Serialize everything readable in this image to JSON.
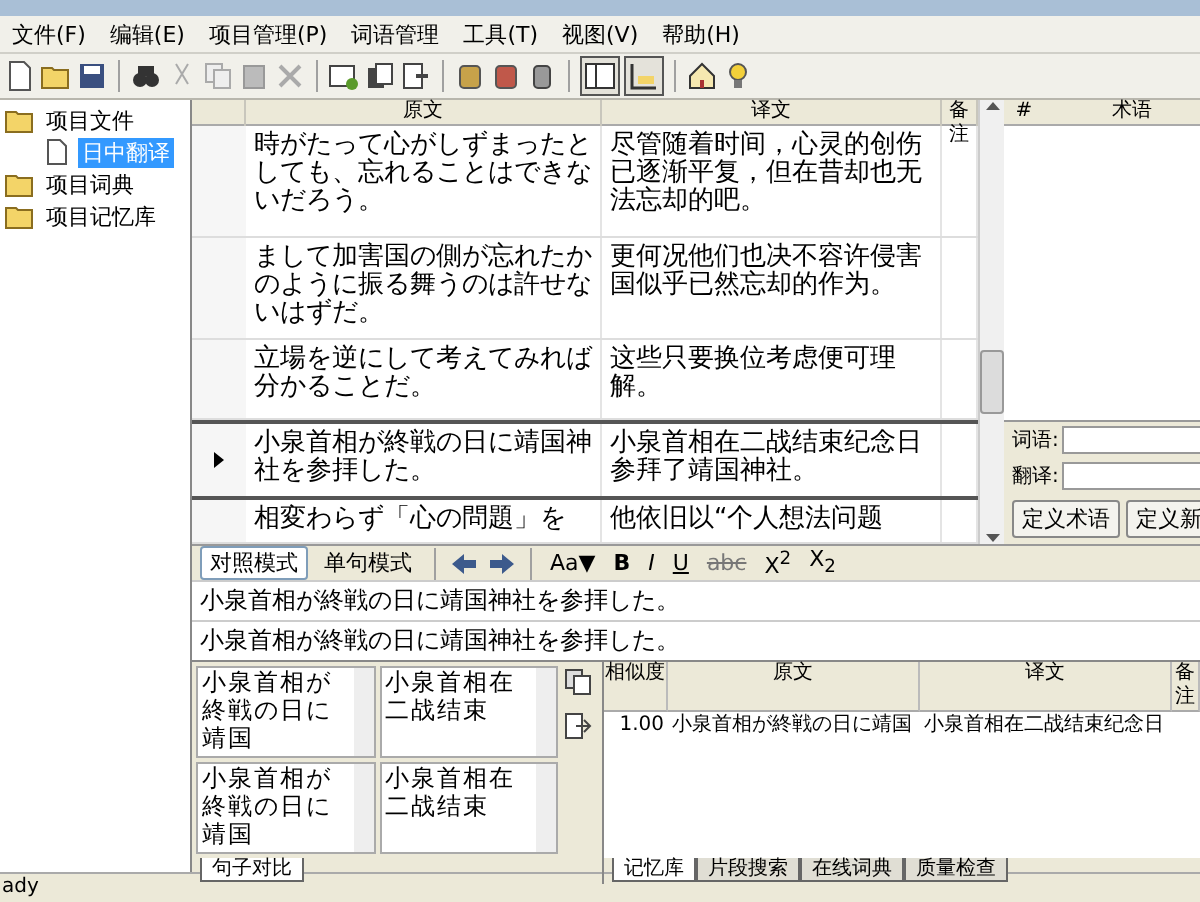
{
  "menu": [
    "文件(F)",
    "编辑(E)",
    "项目管理(P)",
    "词语管理",
    "工具(T)",
    "视图(V)",
    "帮助(H)"
  ],
  "tree": [
    {
      "label": "项目文件",
      "selected": false,
      "children": [
        {
          "label": "日中翻译",
          "selected": true
        }
      ]
    },
    {
      "label": "项目词典",
      "selected": false
    },
    {
      "label": "项目记忆库",
      "selected": false
    }
  ],
  "grid": {
    "columns": [
      "原文",
      "译文",
      "备注"
    ],
    "rows": [
      {
        "source": "時がたって心がしずまったとしても、忘れることはできないだろう。",
        "target": "尽管随着时间，心灵的创伤已逐渐平复，但在昔却也无法忘却的吧。",
        "current": false
      },
      {
        "source": "まして加害国の側が忘れたかのように振る舞うのは許せないはずだ。",
        "target": "更何况他们也决不容许侵害国似乎已然忘却的作为。",
        "current": false
      },
      {
        "source": "立場を逆にして考えてみれば分かることだ。",
        "target": "这些只要换位考虑便可理解。",
        "current": false
      },
      {
        "source": "小泉首相が終戦の日に靖国神社を参拝した。",
        "target": "小泉首相在二战结束纪念日参拜了靖国神社。",
        "current": true
      },
      {
        "source": "相変わらず「心の問題」を",
        "target": "他依旧以“个人想法问题",
        "current": false
      }
    ]
  },
  "terms": {
    "columns": [
      "#",
      "术语"
    ],
    "fields": [
      {
        "label": "词语:"
      },
      {
        "label": "翻译:"
      }
    ],
    "buttons": [
      "定义术语",
      "定义新"
    ]
  },
  "editor": {
    "modes": [
      {
        "label": "对照模式",
        "selected": true
      },
      {
        "label": "单句模式",
        "selected": false
      }
    ],
    "format_buttons": [
      {
        "kind": "font",
        "label": "Aa▼"
      },
      {
        "kind": "bold",
        "label": "B"
      },
      {
        "kind": "italic",
        "label": "I"
      },
      {
        "kind": "underline",
        "label": "U"
      },
      {
        "kind": "strike",
        "label": "abc"
      },
      {
        "kind": "super",
        "label": "X$^{2}$"
      },
      {
        "kind": "sub",
        "label": "X$_{2}$"
      }
    ],
    "lines": [
      "小泉首相が終戦の日に靖国神社を参拝した。",
      "小泉首相が終戦の日に靖国神社を参拝した。"
    ]
  },
  "sentence_compare": {
    "boxes": [
      "小泉首相が終戦の日に靖国",
      "小泉首相在二战结束",
      "小泉首相が終戦の日に靖国",
      "小泉首相在二战结束"
    ],
    "tab": "句子对比"
  },
  "memory": {
    "columns": [
      "相似度",
      "原文",
      "译文",
      "备注"
    ],
    "rows": [
      {
        "score": "1.00",
        "source": "小泉首相が終戦の日に靖国",
        "target": "小泉首相在二战结束纪念日"
      }
    ],
    "tabs": [
      {
        "label": "记忆库",
        "selected": true
      },
      {
        "label": "片段搜索",
        "selected": false
      },
      {
        "label": "在线词典",
        "selected": false
      },
      {
        "label": "质量检查",
        "selected": false
      }
    ]
  },
  "status_bar": "ady"
}
